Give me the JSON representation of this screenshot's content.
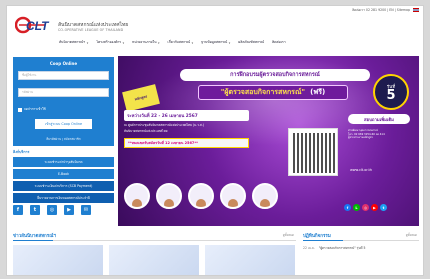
{
  "topbar": {
    "text": "ติดต่อเรา 02 281 9200 | EN | Sitemap"
  },
  "header": {
    "logo_text": "CLT",
    "org_name_th": "สันนิบาตสหกรณ์แห่งประเทศไทย",
    "org_name_en": "CO-OPERATIVE LEAGUE OF THAILAND"
  },
  "nav": {
    "items": [
      {
        "label": "สันนิบาตสหกรณ์ฯ",
        "has_dropdown": true
      },
      {
        "label": "โครงสร้างองค์กร",
        "has_dropdown": true
      },
      {
        "label": "หน่วยงานภายใน",
        "has_dropdown": true
      },
      {
        "label": "เกี่ยวกับสหกรณ์",
        "has_dropdown": true
      },
      {
        "label": "ฐานข้อมูลสหกรณ์",
        "has_dropdown": true
      },
      {
        "label": "ผลิตภัณฑ์สหกรณ์",
        "has_dropdown": false
      },
      {
        "label": "ติดต่อเรา",
        "has_dropdown": false
      }
    ]
  },
  "login": {
    "title": "Coop Online",
    "username_placeholder": "ชื่อผู้ใช้งาน",
    "password_placeholder": "รหัสผ่าน",
    "remember_label": "จดจำการเข้าใช้",
    "button_label": "เข้าสู่ระบบ Coop Online",
    "forgot_label": "ลืมรหัสผ่าน | สมัครสมาชิก"
  },
  "services": {
    "title": "ลิงก์บริการ",
    "items": [
      {
        "label": "ระบบชำระค่าบำรุงสันนิบาต",
        "style": "normal"
      },
      {
        "label": "E-Book",
        "style": "normal"
      },
      {
        "label": "ระบบชำระเงินค่าบริการ (SCB Payment)",
        "style": "dark"
      },
      {
        "label": "ยื่นรายงานการเงินของสหกรณ์ประจำปี",
        "style": "dark"
      }
    ]
  },
  "social": [
    "f",
    "t",
    "ig",
    "yt",
    "tw"
  ],
  "banner": {
    "title": "การฝึกอบรมผู้ตรวจสอบกิจการสหกรณ์",
    "course": "\"ผู้ตรวจสอบกิจการสหกรณ์\"",
    "free_label": "(ฟรี)",
    "ribbon": "หลักสูตร",
    "round_label": "รุ่นที่",
    "round_number": "5",
    "when": "ระหว่างวันที่ 22 - 26 เมษายน 2567",
    "note1": "ณ ศูนย์การประชุมสันนิบาตสหกรณ์แห่งประเทศไทย (ม.ว.ส.)",
    "note2": "สันนิบาตสหกรณ์แห่งประเทศไทย",
    "deadline": "**หมดเขตรับสมัครวันที่ 12 เมษายน 2567**",
    "enroll": "สอบถามเพิ่มเติม",
    "contact_lines": [
      "ฝ่ายพัฒนาบุคลากรสหกรณ์",
      "โทร. 02 669 3254-60 ต่อ 414",
      "ผู้ประสานงานหลักสูตร"
    ],
    "website": "www.clt.or.th",
    "speakers": 5
  },
  "news": {
    "title": "ข่าวสันนิบาตสหกรณ์ฯ",
    "more": "ดูทั้งหมด"
  },
  "events": {
    "title": "ปฏิทินกิจกรรม",
    "more": "ดูทั้งหมด",
    "row": {
      "date": "22 เม.ย.",
      "label": "\"ผู้ตรวจสอบกิจการสหกรณ์\" รุ่นที่ 5"
    }
  },
  "colors": {
    "primary": "#1f7fd0",
    "banner_purple": "#6b1d9a",
    "accent_yellow": "#ffd400",
    "logo_red": "#d71f26"
  }
}
